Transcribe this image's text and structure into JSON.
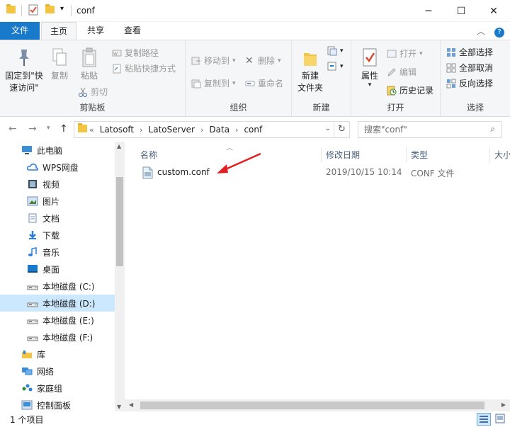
{
  "window": {
    "title": "conf",
    "minimize": "─",
    "maximize": "☐",
    "close": "✕"
  },
  "ribbon_tabs": [
    "文件",
    "主页",
    "共享",
    "查看"
  ],
  "ribbon": {
    "clipboard": {
      "pin_label_1": "固定到\"快",
      "pin_label_2": "速访问\"",
      "copy": "复制",
      "paste": "粘贴",
      "copy_path": "复制路径",
      "paste_shortcut": "粘贴快捷方式",
      "cut": "剪切",
      "group": "剪贴板"
    },
    "organize": {
      "move_to": "移动到",
      "copy_to": "复制到",
      "delete": "删除",
      "rename": "重命名",
      "group": "组织"
    },
    "new": {
      "new_folder_1": "新建",
      "new_folder_2": "文件夹",
      "group": "新建"
    },
    "open": {
      "properties": "属性",
      "open": "打开",
      "edit": "编辑",
      "history": "历史记录",
      "group": "打开"
    },
    "select": {
      "select_all": "全部选择",
      "select_none": "全部取消",
      "invert": "反向选择",
      "group": "选择"
    }
  },
  "address": {
    "crumbs": [
      "Latosoft",
      "LatoServer",
      "Data",
      "conf"
    ],
    "prefix": "«",
    "search_placeholder": "搜索\"conf\""
  },
  "nav": [
    {
      "label": "此电脑",
      "icon": "computer-icon"
    },
    {
      "label": "WPS网盘",
      "icon": "cloud-icon"
    },
    {
      "label": "视频",
      "icon": "video-icon"
    },
    {
      "label": "图片",
      "icon": "picture-icon"
    },
    {
      "label": "文档",
      "icon": "document-icon"
    },
    {
      "label": "下载",
      "icon": "download-icon"
    },
    {
      "label": "音乐",
      "icon": "music-icon"
    },
    {
      "label": "桌面",
      "icon": "desktop-icon"
    },
    {
      "label": "本地磁盘 (C:)",
      "icon": "drive-icon"
    },
    {
      "label": "本地磁盘 (D:)",
      "icon": "drive-icon"
    },
    {
      "label": "本地磁盘 (E:)",
      "icon": "drive-icon"
    },
    {
      "label": "本地磁盘 (F:)",
      "icon": "drive-icon"
    },
    {
      "label": "库",
      "icon": "library-icon"
    },
    {
      "label": "网络",
      "icon": "network-icon"
    },
    {
      "label": "家庭组",
      "icon": "homegroup-icon"
    },
    {
      "label": "控制面板",
      "icon": "control-panel-icon"
    }
  ],
  "columns": [
    "名称",
    "修改日期",
    "类型",
    "大小"
  ],
  "files": [
    {
      "name": "custom.conf",
      "modified": "2019/10/15 10:14",
      "type": "CONF 文件"
    }
  ],
  "status": {
    "count": "1 个项目"
  },
  "colors": {
    "accent": "#1979ca",
    "selected": "#cce8ff",
    "annotation_arrow": "#e02020"
  }
}
